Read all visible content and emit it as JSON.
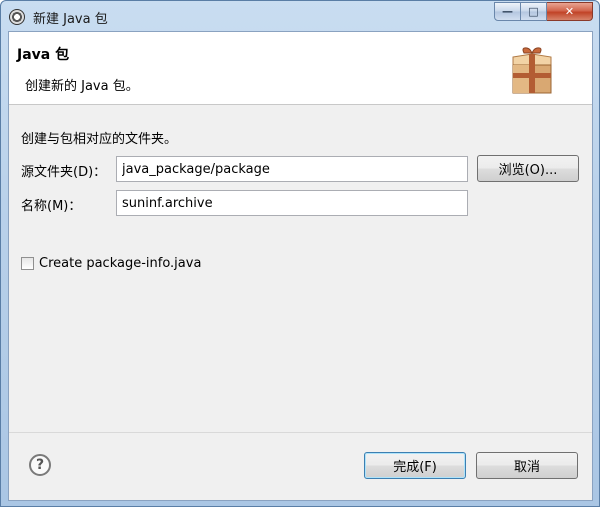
{
  "window": {
    "title": "新建 Java 包",
    "controls": {
      "minimize": "—",
      "maximize": "□",
      "close": "✕"
    }
  },
  "header": {
    "title": "Java 包",
    "description": "创建新的 Java 包。",
    "icon": "package-icon"
  },
  "form": {
    "intro": "创建与包相对应的文件夹。",
    "source_folder": {
      "label": "源文件夹(D)：",
      "value": "java_package/package"
    },
    "browse_label": "浏览(O)...",
    "name": {
      "label": "名称(M)：",
      "value": "suninf.archive"
    },
    "checkbox": {
      "label": "Create package-info.java",
      "checked": false
    }
  },
  "footer": {
    "help_icon": "help-icon",
    "finish_label": "完成(F)",
    "cancel_label": "取消"
  }
}
